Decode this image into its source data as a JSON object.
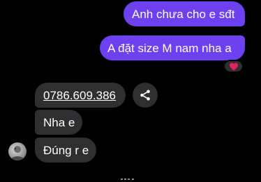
{
  "messages": {
    "outgoing": [
      {
        "text": "Anh chưa cho e sđt"
      },
      {
        "text": "A đặt size M nam nha a"
      }
    ],
    "reaction": {
      "icon": "heart-icon",
      "emoji": "❤️"
    },
    "incoming": [
      {
        "text": "0786.609.386",
        "type": "phone-link"
      },
      {
        "text": "Nha e"
      },
      {
        "text": "Đúng r e"
      }
    ]
  },
  "share_button": {
    "icon": "share-icon"
  },
  "colors": {
    "background": "#000000",
    "outgoing_bubble": "#6d40f0",
    "incoming_bubble": "#2f2f31",
    "heart": "#e0245e"
  }
}
